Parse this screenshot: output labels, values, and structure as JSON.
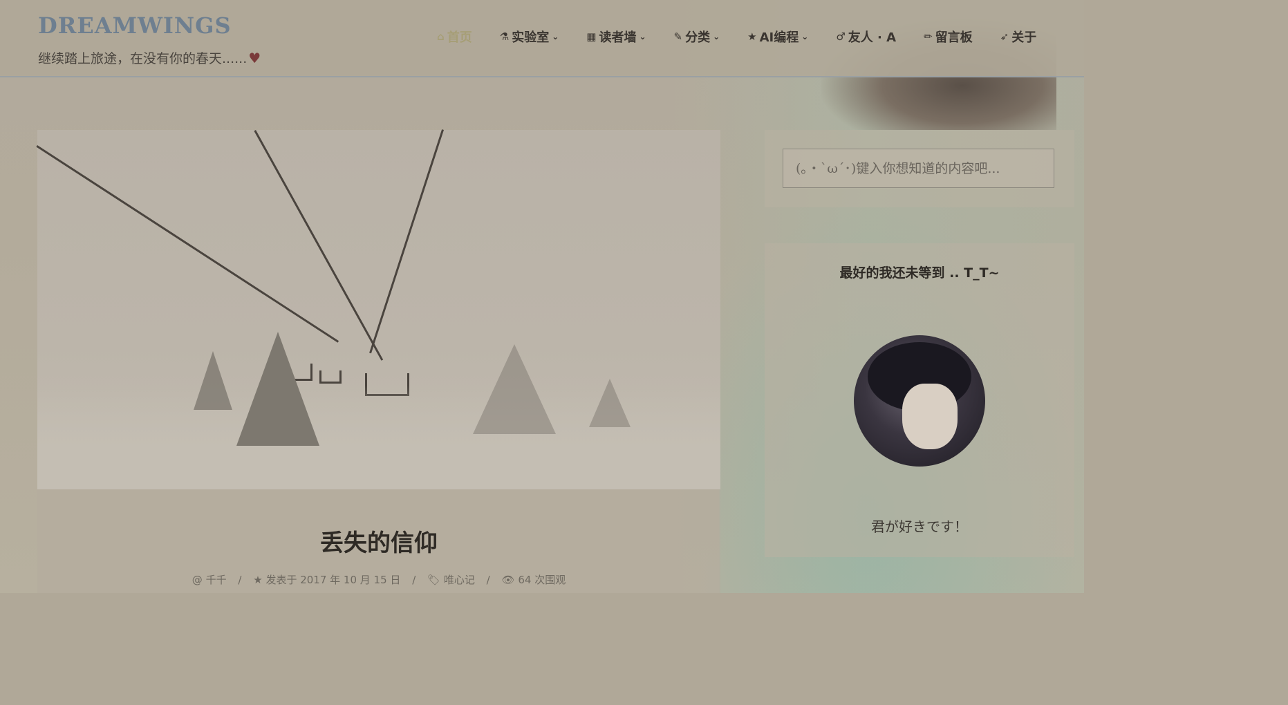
{
  "header": {
    "logo": "DREAMWINGS",
    "tagline": "继续踏上旅途，在没有你的春天......",
    "nav": [
      {
        "label": "首页",
        "icon": "home-icon",
        "active": true,
        "dropdown": false
      },
      {
        "label": "实验室",
        "icon": "flask-icon",
        "active": false,
        "dropdown": true
      },
      {
        "label": "读者墙",
        "icon": "calendar-icon",
        "active": false,
        "dropdown": true
      },
      {
        "label": "分类",
        "icon": "paperclip-icon",
        "active": false,
        "dropdown": true
      },
      {
        "label": "AI编程",
        "icon": "star-icon",
        "active": false,
        "dropdown": true
      },
      {
        "label": "友人 · A",
        "icon": "male-icon",
        "active": false,
        "dropdown": false
      },
      {
        "label": "留言板",
        "icon": "pencil-icon",
        "active": false,
        "dropdown": false
      },
      {
        "label": "关于",
        "icon": "rocket-icon",
        "active": false,
        "dropdown": false
      }
    ]
  },
  "post": {
    "title": "丢失的信仰",
    "author": "千千",
    "date": "发表于 2017 年 10 月 15 日",
    "category": "唯心记",
    "views": "64 次围观"
  },
  "sidebar": {
    "search_placeholder": "(｡・`ω´･)键入你想知道的内容吧...",
    "profile_title": "最好的我还未等到 .. T_T~",
    "profile_motto": "君が好きです！"
  },
  "colors": {
    "accent": "#a69e76",
    "logo": "#6e7f90",
    "heart": "#7a3a3a"
  }
}
